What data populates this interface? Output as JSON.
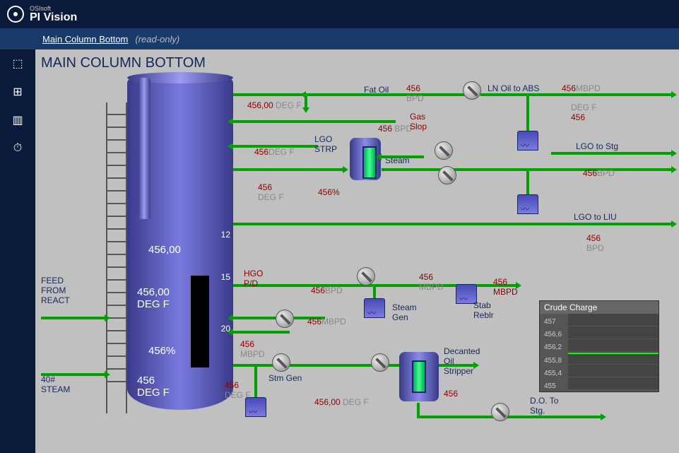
{
  "brand": {
    "company": "OSIsoft",
    "product": "PI Vision"
  },
  "page": {
    "title": "Main Column Bottom",
    "suffix": "(read-only)"
  },
  "diagram": {
    "title": "MAIN COLUMN BOTTOM"
  },
  "feed_label": "FEED\nFROM\nREACT",
  "steam40_label": "40#\nSTEAM",
  "column": {
    "val1": "456,00",
    "val2": "456,00",
    "val2_unit": "DEG F",
    "val3": "456%",
    "val4": "456",
    "val4_unit": "DEG F",
    "tag12": "12",
    "tag15": "15",
    "tag20": "20"
  },
  "r": {
    "fatoil_label": "Fat Oil",
    "fatoil_val": "456",
    "fatoil_unit": "BPD",
    "lnoil_label": "LN Oil to ABS",
    "lnoil_val": "456",
    "lnoil_unit": "MBPD",
    "degf_tr": "DEG F",
    "degf_tr_val": "456",
    "row1_v1": "456,00",
    "row1_u1": "DEG F",
    "row2_v1": "456",
    "row2_u1": "DEG F",
    "row3_v1": "456",
    "row3_u1": "DEG F",
    "lgo_strp_label": "LGO\nSTRP",
    "steam_label": "Steam",
    "gas_slop": "Gas\nSlop",
    "row2b_v": "456",
    "row2b_u": "BPD",
    "lgo_strp_pct": "456%",
    "lgo_stg_label": "LGO to Stg",
    "lgo_stg_v": "456",
    "lgo_stg_u": "BPD",
    "lgo_liu_label": "LGO to LIU",
    "lgo_liu_v": "456",
    "lgo_liu_u": "BPD",
    "hgo_label": "HGO\nP/D",
    "hgo_v1": "456",
    "hgo_u1": "BPD",
    "hgo_v2": "456",
    "hgo_u2": "MBPD",
    "steam_gen_label": "Steam\nGen",
    "stab_label": "456\nMBPD",
    "stab_reblr_label": "Stab\nReblr",
    "midrow_v": "456",
    "midrow_u": "MBPD",
    "stmgen_top_v": "456",
    "stmgen_top_u": "MBPD",
    "stmgen_label": "Stm Gen",
    "stmgen_bot_v": "456",
    "stmgen_bot_u": "DEG F",
    "stmgen_right_v": "456,00",
    "stmgen_right_u": "DEG F",
    "decanted_label": "Decanted\nOil\nStripper",
    "decanted_val": "456",
    "do_stg_label": "D.O. To\nStg."
  },
  "trend": {
    "title": "Crude Charge",
    "yticks": [
      "457",
      "456,6",
      "456,2",
      "455,8",
      "455,4",
      "455"
    ]
  }
}
